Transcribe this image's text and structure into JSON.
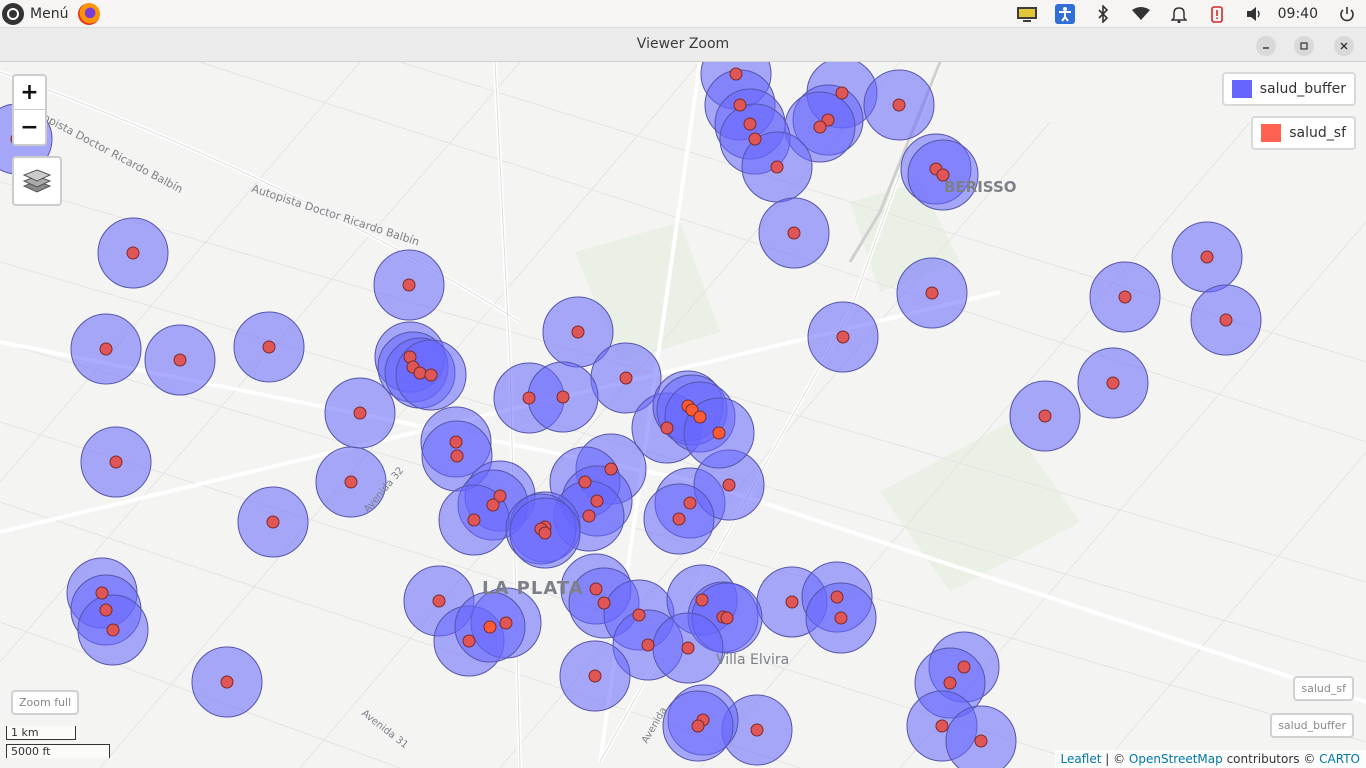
{
  "topbar": {
    "menu_label": "Menú",
    "clock": "09:40",
    "tray_icons": [
      "display-icon",
      "accessibility-icon",
      "bluetooth-icon",
      "wifi-icon",
      "notification-icon",
      "battery-alert-icon",
      "volume-icon",
      "power-icon"
    ]
  },
  "window": {
    "title": "Viewer Zoom",
    "minimize_icon": "minimize-icon",
    "maximize_icon": "maximize-icon",
    "close_icon": "close-icon"
  },
  "map": {
    "zoom_in_label": "+",
    "zoom_out_label": "−",
    "layers_icon": "layers-icon",
    "legend": [
      {
        "name": "salud_buffer",
        "color": "#6666ff"
      },
      {
        "name": "salud_sf",
        "color": "#ff6250"
      }
    ],
    "zoom_full_label": "Zoom full",
    "layer_buttons": [
      "salud_sf",
      "salud_buffer"
    ],
    "scale": {
      "metric": "1 km",
      "imperial": "5000 ft"
    },
    "place_labels": {
      "la_plata": "LA PLATA",
      "berisso": "BERISSO",
      "villa_elvira": "Villa Elvira",
      "autopista_1": "Autopista Doctor Ricardo Balbín",
      "autopista_2": "Autopista Doctor Ricardo Balbín",
      "avenida_32": "Avenida 32",
      "avenida_31": "Avenida 31",
      "avenida": "Avenida"
    },
    "attribution": {
      "leaflet": "Leaflet",
      "sep": " | © ",
      "osm": "OpenStreetMap",
      "contrib": " contributors © ",
      "carto": "CARTO"
    },
    "colors": {
      "buffer_fill": "#6666ff",
      "buffer_stroke": "#5555aa",
      "point_fill": "#e05555",
      "point_stroke": "#7a2b2b",
      "highlight_point": "#ff5a36"
    }
  }
}
